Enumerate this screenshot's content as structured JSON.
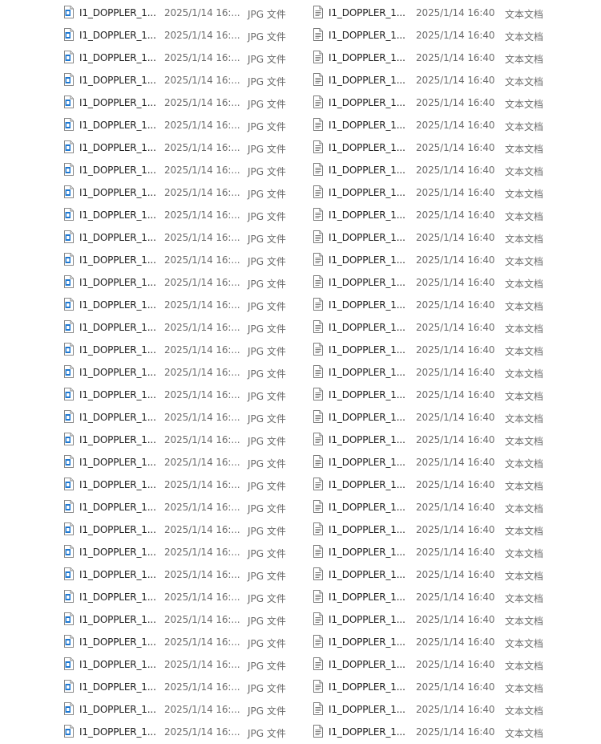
{
  "jpg_pane": {
    "icon": "jpg-file-icon",
    "rows": [
      {
        "name": "I1_DOPPLER_1...",
        "date": "2025/1/14 16:...",
        "type": "JPG 文件"
      },
      {
        "name": "I1_DOPPLER_1...",
        "date": "2025/1/14 16:...",
        "type": "JPG 文件"
      },
      {
        "name": "I1_DOPPLER_1...",
        "date": "2025/1/14 16:...",
        "type": "JPG 文件"
      },
      {
        "name": "I1_DOPPLER_1...",
        "date": "2025/1/14 16:...",
        "type": "JPG 文件"
      },
      {
        "name": "I1_DOPPLER_1...",
        "date": "2025/1/14 16:...",
        "type": "JPG 文件"
      },
      {
        "name": "I1_DOPPLER_1...",
        "date": "2025/1/14 16:...",
        "type": "JPG 文件"
      },
      {
        "name": "I1_DOPPLER_1...",
        "date": "2025/1/14 16:...",
        "type": "JPG 文件"
      },
      {
        "name": "I1_DOPPLER_1...",
        "date": "2025/1/14 16:...",
        "type": "JPG 文件"
      },
      {
        "name": "I1_DOPPLER_1...",
        "date": "2025/1/14 16:...",
        "type": "JPG 文件"
      },
      {
        "name": "I1_DOPPLER_1...",
        "date": "2025/1/14 16:...",
        "type": "JPG 文件"
      },
      {
        "name": "I1_DOPPLER_1...",
        "date": "2025/1/14 16:...",
        "type": "JPG 文件"
      },
      {
        "name": "I1_DOPPLER_1...",
        "date": "2025/1/14 16:...",
        "type": "JPG 文件"
      },
      {
        "name": "I1_DOPPLER_1...",
        "date": "2025/1/14 16:...",
        "type": "JPG 文件"
      },
      {
        "name": "I1_DOPPLER_1...",
        "date": "2025/1/14 16:...",
        "type": "JPG 文件"
      },
      {
        "name": "I1_DOPPLER_1...",
        "date": "2025/1/14 16:...",
        "type": "JPG 文件"
      },
      {
        "name": "I1_DOPPLER_1...",
        "date": "2025/1/14 16:...",
        "type": "JPG 文件"
      },
      {
        "name": "I1_DOPPLER_1...",
        "date": "2025/1/14 16:...",
        "type": "JPG 文件"
      },
      {
        "name": "I1_DOPPLER_1...",
        "date": "2025/1/14 16:...",
        "type": "JPG 文件"
      },
      {
        "name": "I1_DOPPLER_1...",
        "date": "2025/1/14 16:...",
        "type": "JPG 文件"
      },
      {
        "name": "I1_DOPPLER_1...",
        "date": "2025/1/14 16:...",
        "type": "JPG 文件"
      },
      {
        "name": "I1_DOPPLER_1...",
        "date": "2025/1/14 16:...",
        "type": "JPG 文件"
      },
      {
        "name": "I1_DOPPLER_1...",
        "date": "2025/1/14 16:...",
        "type": "JPG 文件"
      },
      {
        "name": "I1_DOPPLER_1...",
        "date": "2025/1/14 16:...",
        "type": "JPG 文件"
      },
      {
        "name": "I1_DOPPLER_1...",
        "date": "2025/1/14 16:...",
        "type": "JPG 文件"
      },
      {
        "name": "I1_DOPPLER_1...",
        "date": "2025/1/14 16:...",
        "type": "JPG 文件"
      },
      {
        "name": "I1_DOPPLER_1...",
        "date": "2025/1/14 16:...",
        "type": "JPG 文件"
      },
      {
        "name": "I1_DOPPLER_1...",
        "date": "2025/1/14 16:...",
        "type": "JPG 文件"
      },
      {
        "name": "I1_DOPPLER_1...",
        "date": "2025/1/14 16:...",
        "type": "JPG 文件"
      },
      {
        "name": "I1_DOPPLER_1...",
        "date": "2025/1/14 16:...",
        "type": "JPG 文件"
      },
      {
        "name": "I1_DOPPLER_1...",
        "date": "2025/1/14 16:...",
        "type": "JPG 文件"
      },
      {
        "name": "I1_DOPPLER_1...",
        "date": "2025/1/14 16:...",
        "type": "JPG 文件"
      },
      {
        "name": "I1_DOPPLER_1...",
        "date": "2025/1/14 16:...",
        "type": "JPG 文件"
      },
      {
        "name": "I1_DOPPLER_1...",
        "date": "2025/1/14 16:...",
        "type": "JPG 文件"
      }
    ]
  },
  "txt_pane": {
    "icon": "text-document-icon",
    "rows": [
      {
        "name": "I1_DOPPLER_1...",
        "date": "2025/1/14 16:40",
        "type": "文本文档"
      },
      {
        "name": "I1_DOPPLER_1...",
        "date": "2025/1/14 16:40",
        "type": "文本文档"
      },
      {
        "name": "I1_DOPPLER_1...",
        "date": "2025/1/14 16:40",
        "type": "文本文档"
      },
      {
        "name": "I1_DOPPLER_1...",
        "date": "2025/1/14 16:40",
        "type": "文本文档"
      },
      {
        "name": "I1_DOPPLER_1...",
        "date": "2025/1/14 16:40",
        "type": "文本文档"
      },
      {
        "name": "I1_DOPPLER_1...",
        "date": "2025/1/14 16:40",
        "type": "文本文档"
      },
      {
        "name": "I1_DOPPLER_1...",
        "date": "2025/1/14 16:40",
        "type": "文本文档"
      },
      {
        "name": "I1_DOPPLER_1...",
        "date": "2025/1/14 16:40",
        "type": "文本文档"
      },
      {
        "name": "I1_DOPPLER_1...",
        "date": "2025/1/14 16:40",
        "type": "文本文档"
      },
      {
        "name": "I1_DOPPLER_1...",
        "date": "2025/1/14 16:40",
        "type": "文本文档"
      },
      {
        "name": "I1_DOPPLER_1...",
        "date": "2025/1/14 16:40",
        "type": "文本文档"
      },
      {
        "name": "I1_DOPPLER_1...",
        "date": "2025/1/14 16:40",
        "type": "文本文档"
      },
      {
        "name": "I1_DOPPLER_1...",
        "date": "2025/1/14 16:40",
        "type": "文本文档"
      },
      {
        "name": "I1_DOPPLER_1...",
        "date": "2025/1/14 16:40",
        "type": "文本文档"
      },
      {
        "name": "I1_DOPPLER_1...",
        "date": "2025/1/14 16:40",
        "type": "文本文档"
      },
      {
        "name": "I1_DOPPLER_1...",
        "date": "2025/1/14 16:40",
        "type": "文本文档"
      },
      {
        "name": "I1_DOPPLER_1...",
        "date": "2025/1/14 16:40",
        "type": "文本文档"
      },
      {
        "name": "I1_DOPPLER_1...",
        "date": "2025/1/14 16:40",
        "type": "文本文档"
      },
      {
        "name": "I1_DOPPLER_1...",
        "date": "2025/1/14 16:40",
        "type": "文本文档"
      },
      {
        "name": "I1_DOPPLER_1...",
        "date": "2025/1/14 16:40",
        "type": "文本文档"
      },
      {
        "name": "I1_DOPPLER_1...",
        "date": "2025/1/14 16:40",
        "type": "文本文档"
      },
      {
        "name": "I1_DOPPLER_1...",
        "date": "2025/1/14 16:40",
        "type": "文本文档"
      },
      {
        "name": "I1_DOPPLER_1...",
        "date": "2025/1/14 16:40",
        "type": "文本文档"
      },
      {
        "name": "I1_DOPPLER_1...",
        "date": "2025/1/14 16:40",
        "type": "文本文档"
      },
      {
        "name": "I1_DOPPLER_1...",
        "date": "2025/1/14 16:40",
        "type": "文本文档"
      },
      {
        "name": "I1_DOPPLER_1...",
        "date": "2025/1/14 16:40",
        "type": "文本文档"
      },
      {
        "name": "I1_DOPPLER_1...",
        "date": "2025/1/14 16:40",
        "type": "文本文档"
      },
      {
        "name": "I1_DOPPLER_1...",
        "date": "2025/1/14 16:40",
        "type": "文本文档"
      },
      {
        "name": "I1_DOPPLER_1...",
        "date": "2025/1/14 16:40",
        "type": "文本文档"
      },
      {
        "name": "I1_DOPPLER_1...",
        "date": "2025/1/14 16:40",
        "type": "文本文档"
      },
      {
        "name": "I1_DOPPLER_1...",
        "date": "2025/1/14 16:40",
        "type": "文本文档"
      },
      {
        "name": "I1_DOPPLER_1...",
        "date": "2025/1/14 16:40",
        "type": "文本文档"
      },
      {
        "name": "I1_DOPPLER_1...",
        "date": "2025/1/14 16:40",
        "type": "文本文档"
      }
    ]
  }
}
